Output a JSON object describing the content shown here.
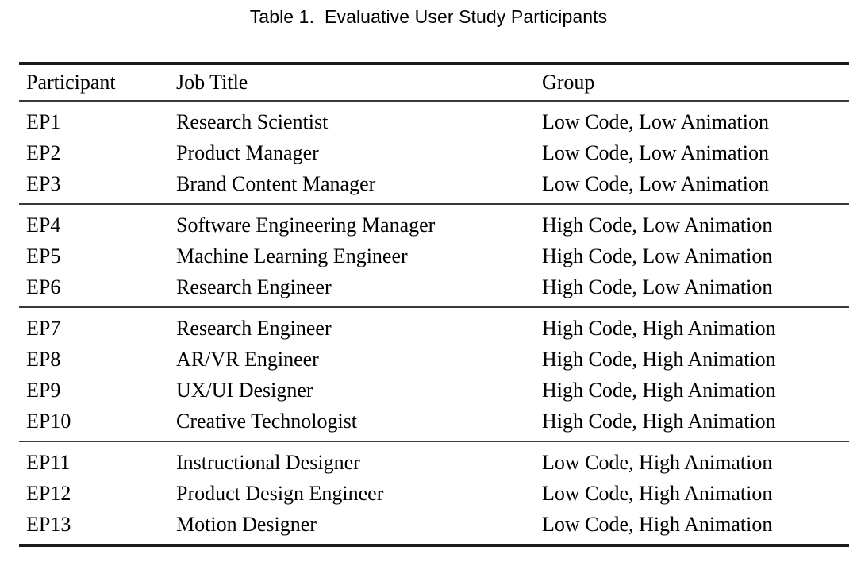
{
  "caption": {
    "label": "Table 1.",
    "text": "Evaluative User Study Participants",
    "full": "Table 1.  Evaluative User Study Participants"
  },
  "table": {
    "columns": [
      {
        "key": "participant",
        "header": "Participant"
      },
      {
        "key": "job_title",
        "header": "Job Title"
      },
      {
        "key": "group",
        "header": "Group"
      }
    ],
    "groups": [
      {
        "group_label": "Low Code, Low Animation",
        "rows": [
          {
            "participant": "EP1",
            "job_title": "Research Scientist",
            "group": "Low Code, Low Animation"
          },
          {
            "participant": "EP2",
            "job_title": "Product Manager",
            "group": "Low Code, Low Animation"
          },
          {
            "participant": "EP3",
            "job_title": "Brand Content Manager",
            "group": "Low Code, Low Animation"
          }
        ]
      },
      {
        "group_label": "High Code, Low Animation",
        "rows": [
          {
            "participant": "EP4",
            "job_title": "Software Engineering Manager",
            "group": "High Code, Low Animation"
          },
          {
            "participant": "EP5",
            "job_title": "Machine Learning Engineer",
            "group": "High Code, Low Animation"
          },
          {
            "participant": "EP6",
            "job_title": "Research Engineer",
            "group": "High Code, Low Animation"
          }
        ]
      },
      {
        "group_label": "High Code, High Animation",
        "rows": [
          {
            "participant": "EP7",
            "job_title": "Research Engineer",
            "group": "High Code, High Animation"
          },
          {
            "participant": "EP8",
            "job_title": "AR/VR Engineer",
            "group": "High Code, High Animation"
          },
          {
            "participant": "EP9",
            "job_title": "UX/UI Designer",
            "group": "High Code, High Animation"
          },
          {
            "participant": "EP10",
            "job_title": "Creative Technologist",
            "group": "High Code, High Animation"
          }
        ]
      },
      {
        "group_label": "Low Code, High Animation",
        "rows": [
          {
            "participant": "EP11",
            "job_title": "Instructional Designer",
            "group": "Low Code, High Animation"
          },
          {
            "participant": "EP12",
            "job_title": "Product Design Engineer",
            "group": "Low Code, High Animation"
          },
          {
            "participant": "EP13",
            "job_title": "Motion Designer",
            "group": "Low Code, High Animation"
          }
        ]
      }
    ]
  },
  "colors": {
    "text": "#000000",
    "rule_heavy": "#1a1a1a",
    "rule_light": "#3a3a3a",
    "background": "#ffffff"
  }
}
